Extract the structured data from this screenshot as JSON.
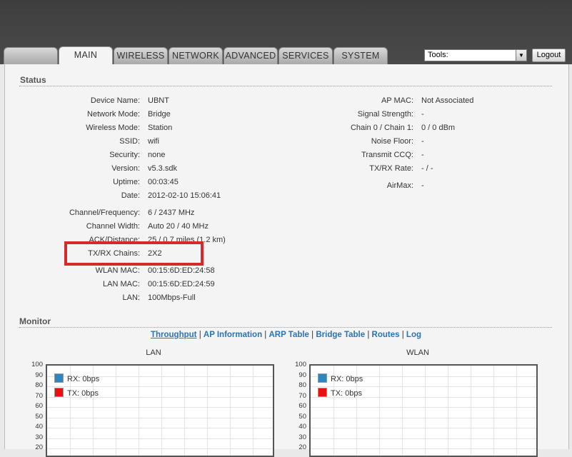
{
  "tabs": [
    {
      "label": ""
    },
    {
      "label": "MAIN"
    },
    {
      "label": "WIRELESS"
    },
    {
      "label": "NETWORK"
    },
    {
      "label": "ADVANCED"
    },
    {
      "label": "SERVICES"
    },
    {
      "label": "SYSTEM"
    }
  ],
  "tools": {
    "selected": "Tools:"
  },
  "logout_label": "Logout",
  "status": {
    "title": "Status",
    "left": [
      {
        "label": "Device Name:",
        "value": "UBNT"
      },
      {
        "label": "Network Mode:",
        "value": "Bridge"
      },
      {
        "label": "Wireless Mode:",
        "value": "Station"
      },
      {
        "label": "SSID:",
        "value": "wifi"
      },
      {
        "label": "Security:",
        "value": "none"
      },
      {
        "label": "Version:",
        "value": "v5.3.sdk"
      },
      {
        "label": "Uptime:",
        "value": "00:03:45"
      },
      {
        "label": "Date:",
        "value": "2012-02-10 15:06:41"
      },
      {
        "label": "Channel/Frequency:",
        "value": "6 / 2437 MHz"
      },
      {
        "label": "Channel Width:",
        "value": "Auto 20 / 40 MHz"
      },
      {
        "label": "ACK/Distance:",
        "value": "25 / 0.7 miles (1.2 km)"
      },
      {
        "label": "TX/RX Chains:",
        "value": "2X2"
      },
      {
        "label": "WLAN MAC:",
        "value": "00:15:6D:ED:24:58"
      },
      {
        "label": "LAN MAC:",
        "value": "00:15:6D:ED:24:59"
      },
      {
        "label": "LAN:",
        "value": "100Mbps-Full"
      }
    ],
    "right": [
      {
        "label": "AP MAC:",
        "value": "Not Associated"
      },
      {
        "label": "Signal Strength:",
        "value": "-"
      },
      {
        "label": "Chain 0 / Chain 1:",
        "value": "0 / 0 dBm"
      },
      {
        "label": "Noise Floor:",
        "value": "-"
      },
      {
        "label": "Transmit CCQ:",
        "value": "-"
      },
      {
        "label": "TX/RX Rate:",
        "value": "- / -"
      },
      {
        "label": "AirMax:",
        "value": "-"
      }
    ]
  },
  "monitor": {
    "title": "Monitor",
    "links": [
      "Throughput",
      "AP Information",
      "ARP Table",
      "Bridge Table",
      "Routes",
      "Log"
    ],
    "charts": [
      {
        "title": "LAN",
        "legend": [
          {
            "label": "RX: 0bps",
            "color": "#2e86c1"
          },
          {
            "label": "TX: 0bps",
            "color": "#e81010"
          }
        ]
      },
      {
        "title": "WLAN",
        "legend": [
          {
            "label": "RX: 0bps",
            "color": "#2e86c1"
          },
          {
            "label": "TX: 0bps",
            "color": "#e81010"
          }
        ]
      }
    ],
    "yticks": [
      "100",
      "90",
      "80",
      "70",
      "60",
      "50",
      "40",
      "30",
      "20"
    ]
  },
  "colors": {
    "link": "#2a74b4",
    "highlight": "#d42a2a",
    "rx": "#2e86c1",
    "tx": "#e81010"
  }
}
